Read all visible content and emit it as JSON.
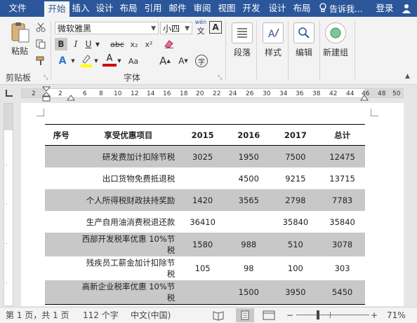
{
  "menu": {
    "tabs": [
      "文件",
      "开始",
      "插入",
      "设计",
      "布局",
      "引用",
      "邮件",
      "审阅",
      "视图",
      "开发",
      "设计",
      "布局"
    ],
    "active_tab": "开始",
    "tell_me": "告诉我...",
    "login": "登录"
  },
  "ribbon": {
    "clipboard": {
      "paste_label": "粘贴",
      "group_label": "剪贴板"
    },
    "font": {
      "font_name": "微软雅黑",
      "font_size": "小四",
      "wen_label": "wén",
      "bold": "B",
      "italic": "I",
      "underline": "U",
      "strike": "abc",
      "subscript": "x₂",
      "superscript": "x²",
      "case_label": "Aa",
      "grow": "A",
      "shrink": "A",
      "group_label": "字体"
    },
    "paragraph_label": "段落",
    "styles_label": "样式",
    "editing_label": "编辑",
    "newgroup_label": "新建组"
  },
  "ruler": {
    "numbers": [
      "2",
      "2",
      "6",
      "8",
      "10",
      "12",
      "14",
      "16",
      "18",
      "20",
      "22",
      "24",
      "26",
      "30",
      "34",
      "36",
      "38",
      "42",
      "44",
      "46",
      "48",
      "50"
    ]
  },
  "document": {
    "headers": [
      "序号",
      "享受优惠项目",
      "2015",
      "2016",
      "2017",
      "总计"
    ],
    "rows": [
      [
        "",
        "研发费加计扣除节税",
        "3025",
        "1950",
        "7500",
        "12475"
      ],
      [
        "",
        "出口货物免费抵退税",
        "",
        "4500",
        "9215",
        "13715"
      ],
      [
        "",
        "个人所得税财政扶持奖励",
        "1420",
        "3565",
        "2798",
        "7783"
      ],
      [
        "",
        "生产自用油消费税退还款",
        "36410",
        "",
        "35840",
        "35840"
      ],
      [
        "",
        "西部开发税率优惠 10%节税",
        "1580",
        "988",
        "510",
        "3078"
      ],
      [
        "",
        "残疾员工薪金加计扣除节税",
        "105",
        "98",
        "100",
        "303"
      ],
      [
        "",
        "高新企业税率优惠 10%节税",
        "",
        "1500",
        "3950",
        "5450"
      ]
    ]
  },
  "status": {
    "page": "第 1 页，共 1 页",
    "words": "112 个字",
    "lang": "中文(中国)",
    "zoom_minus": "−",
    "zoom_plus": "+",
    "zoom": "71%"
  },
  "colors": {
    "accent": "#2b579a",
    "row_shade": "#c8c8c8",
    "highlight": "#ffff00",
    "font_red": "#d00000"
  }
}
